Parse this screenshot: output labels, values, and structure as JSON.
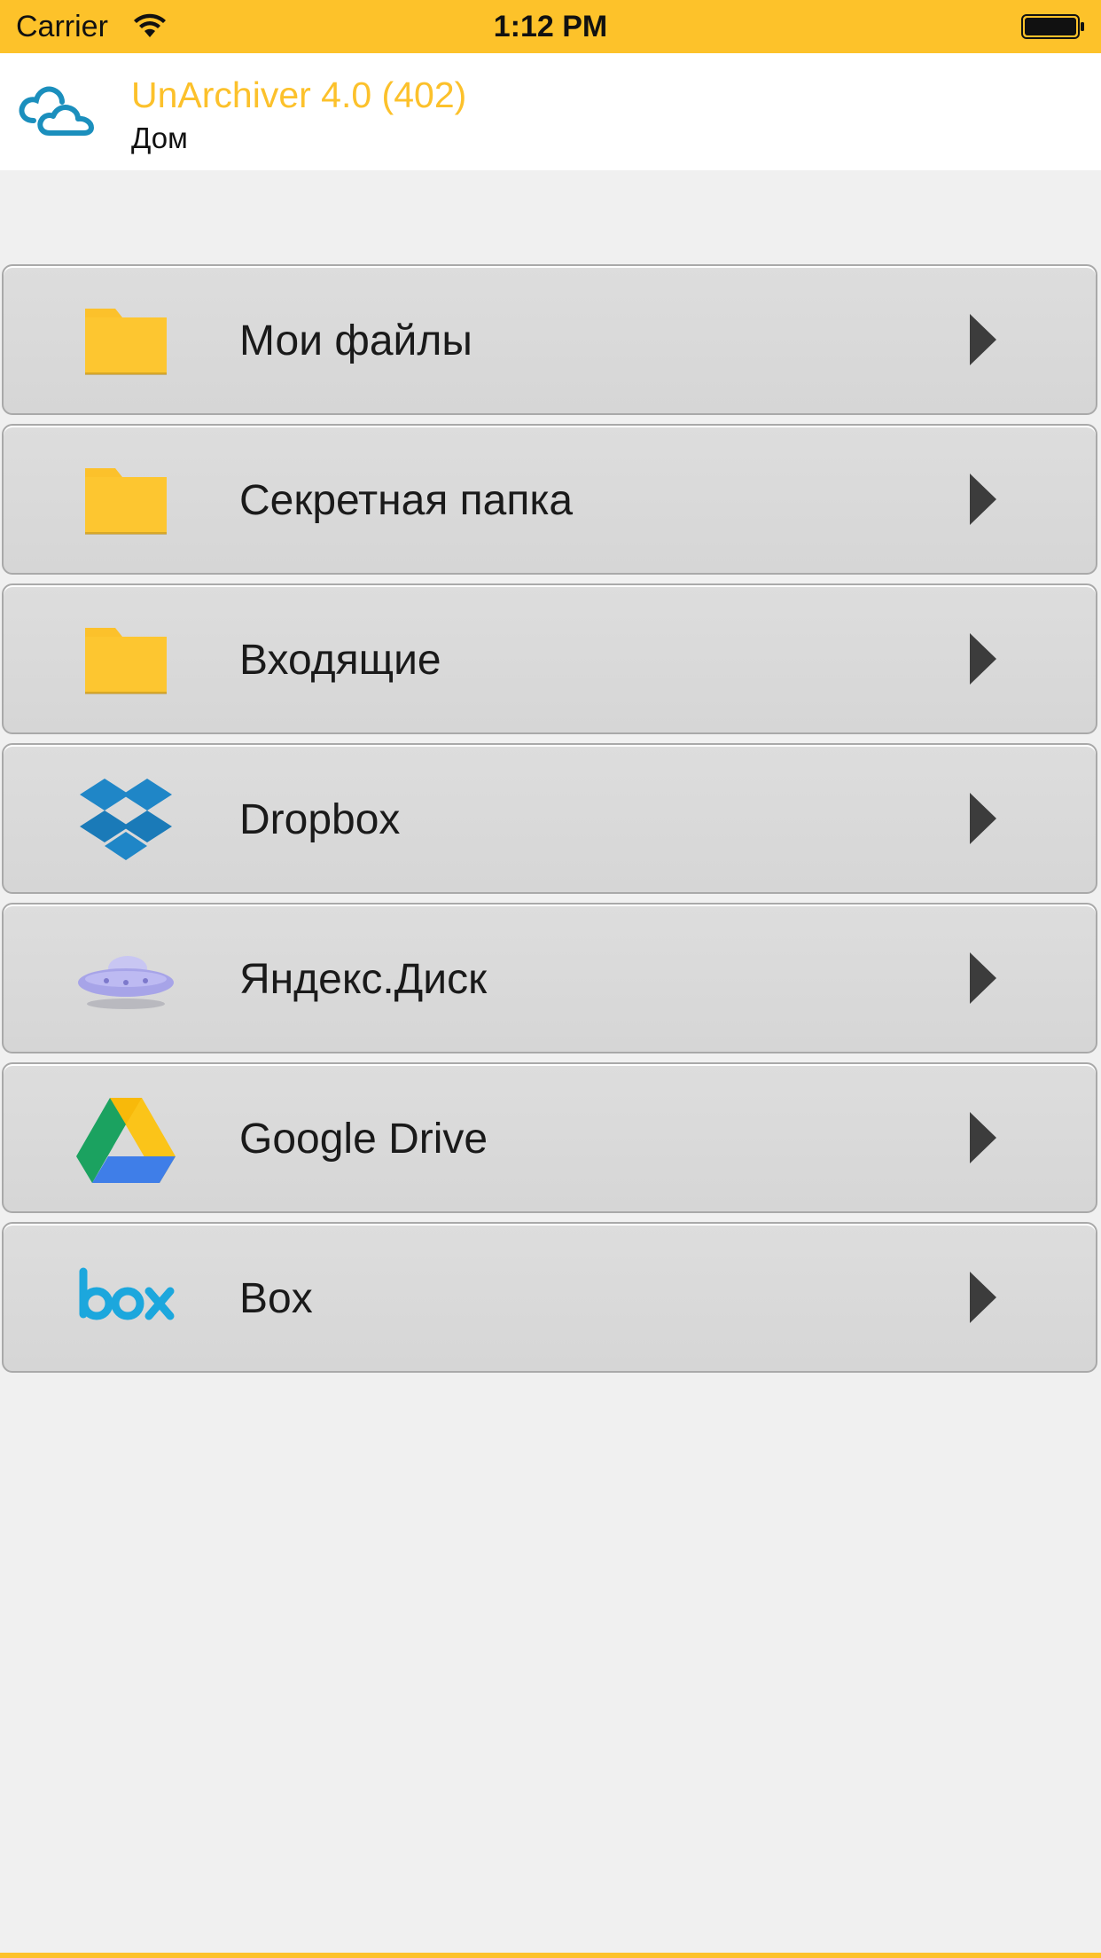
{
  "status_bar": {
    "carrier": "Carrier",
    "time": "1:12 PM",
    "wifi_icon": "wifi-icon",
    "battery_icon": "battery-icon",
    "background_color": "#fdc22a"
  },
  "header": {
    "logo_icon": "cloud-sync-icon",
    "title": "UnArchiver 4.0 (402)",
    "subtitle": "Дом",
    "title_color": "#fcc12b"
  },
  "menu": {
    "items": [
      {
        "label": "Мои файлы",
        "icon": "folder-icon"
      },
      {
        "label": "Секретная папка",
        "icon": "folder-icon"
      },
      {
        "label": "Входящие",
        "icon": "folder-icon"
      },
      {
        "label": "Dropbox",
        "icon": "dropbox-icon"
      },
      {
        "label": "Яндекс.Диск",
        "icon": "ufo-icon"
      },
      {
        "label": "Google Drive",
        "icon": "google-drive-icon"
      },
      {
        "label": "Box",
        "icon": "box-logo-icon"
      }
    ],
    "arrow_icon": "chevron-right-icon"
  }
}
